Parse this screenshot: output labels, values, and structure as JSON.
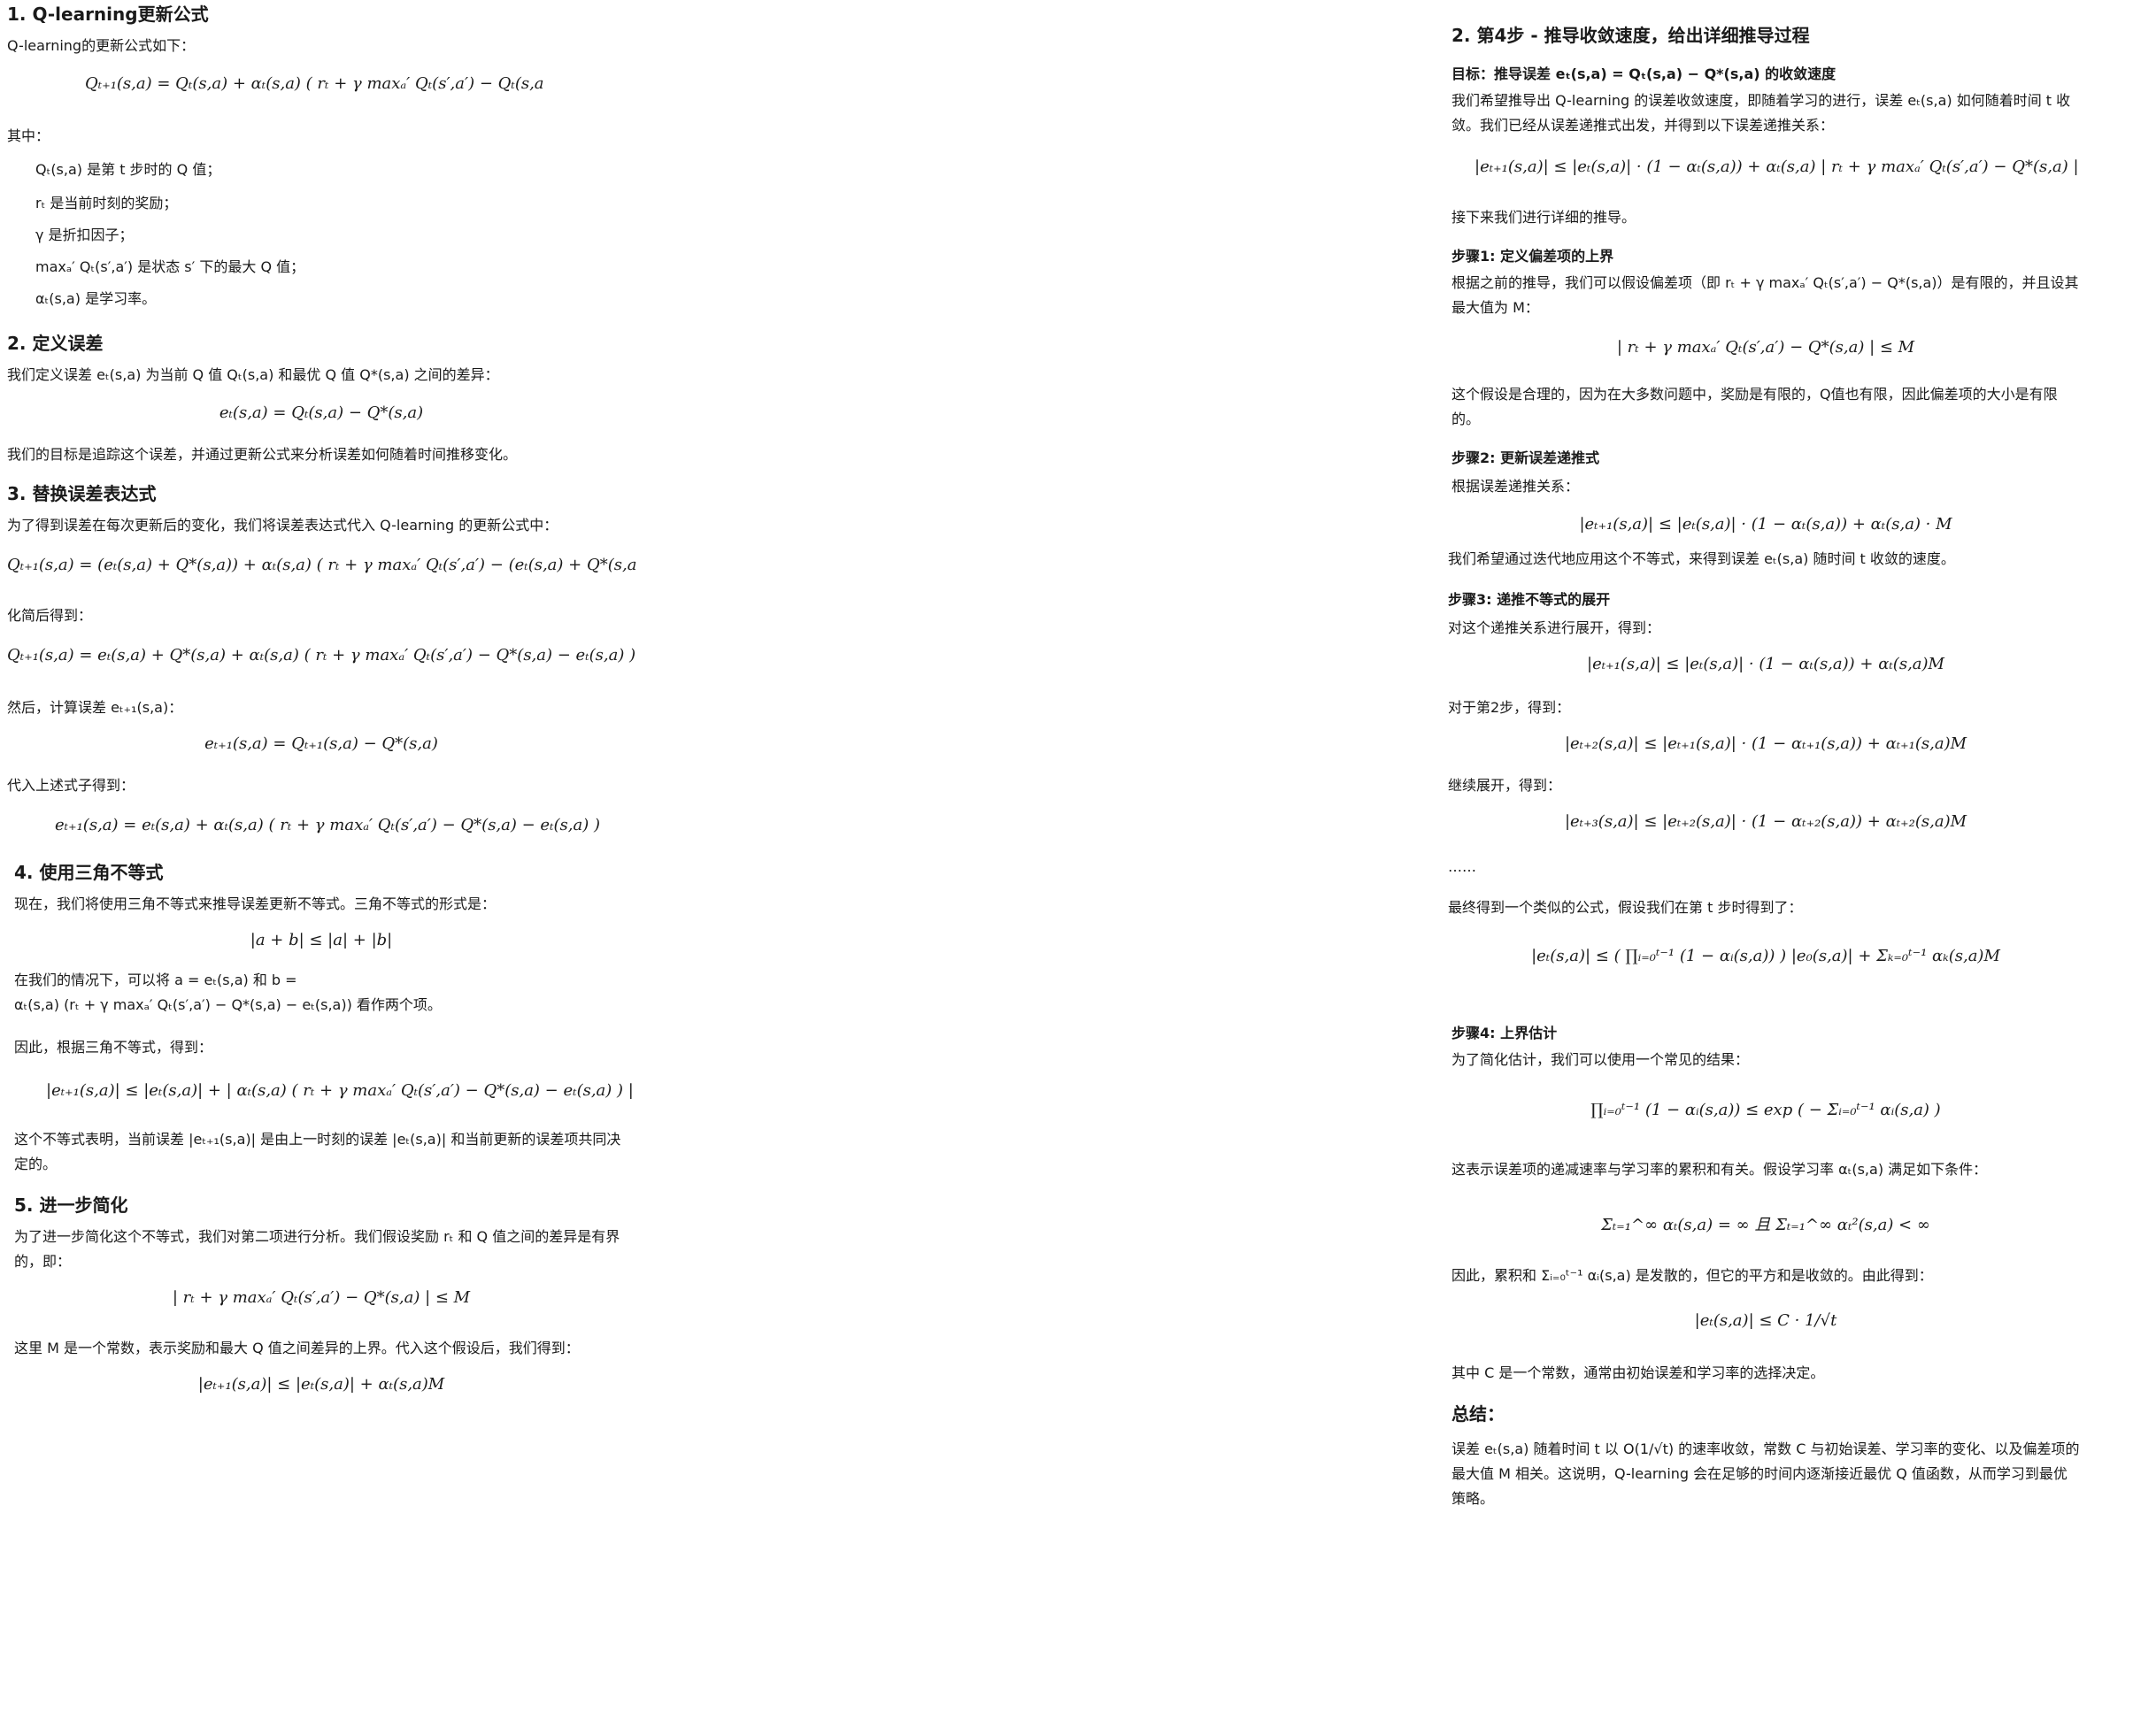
{
  "left": {
    "s1_title": "1. Q-learning更新公式",
    "s1_intro": "Q-learning的更新公式如下：",
    "s1_formula": "Qₜ₊₁(s,a) = Qₜ(s,a) + αₜ(s,a) ( rₜ + γ maxₐ′ Qₜ(s′,a′) − Qₜ(s,a",
    "s1_where": "其中：",
    "s1_items": [
      "Qₜ(s,a) 是第 t 步时的 Q 值；",
      "rₜ 是当前时刻的奖励；",
      "γ 是折扣因子；",
      "maxₐ′ Qₜ(s′,a′) 是状态 s′ 下的最大 Q 值；",
      "αₜ(s,a) 是学习率。"
    ],
    "s2_title": "2. 定义误差",
    "s2_text": "我们定义误差 eₜ(s,a) 为当前 Q 值 Qₜ(s,a) 和最优 Q 值 Q*(s,a) 之间的差异：",
    "s2_formula": "eₜ(s,a) = Qₜ(s,a) − Q*(s,a)",
    "s2_text2": "我们的目标是追踪这个误差，并通过更新公式来分析误差如何随着时间推移变化。",
    "s3_title": "3. 替换误差表达式",
    "s3_text": "为了得到误差在每次更新后的变化，我们将误差表达式代入 Q-learning 的更新公式中：",
    "s3_formula1": "Qₜ₊₁(s,a) = (eₜ(s,a) + Q*(s,a)) + αₜ(s,a) ( rₜ + γ maxₐ′ Qₜ(s′,a′) − (eₜ(s,a) + Q*(s,a",
    "s3_text2": "化简后得到：",
    "s3_formula2": "Qₜ₊₁(s,a) = eₜ(s,a) + Q*(s,a) + αₜ(s,a) ( rₜ + γ maxₐ′ Qₜ(s′,a′) − Q*(s,a) − eₜ(s,a) )",
    "s3_text3": "然后，计算误差 eₜ₊₁(s,a)：",
    "s3_formula3": "eₜ₊₁(s,a) = Qₜ₊₁(s,a) − Q*(s,a)",
    "s3_text4": "代入上述式子得到：",
    "s3_formula4": "eₜ₊₁(s,a) = eₜ(s,a) + αₜ(s,a) ( rₜ + γ maxₐ′ Qₜ(s′,a′) − Q*(s,a) − eₜ(s,a) )",
    "s4_title": "4. 使用三角不等式",
    "s4_text": "现在，我们将使用三角不等式来推导误差更新不等式。三角不等式的形式是：",
    "s4_formula1": "|a + b| ≤ |a| + |b|",
    "s4_text2a": "在我们的情况下，可以将 a = eₜ(s,a) 和 b =",
    "s4_text2b": "αₜ(s,a) (rₜ + γ maxₐ′ Qₜ(s′,a′) − Q*(s,a) − eₜ(s,a)) 看作两个项。",
    "s4_text3": "因此，根据三角不等式，得到：",
    "s4_formula2": "|eₜ₊₁(s,a)| ≤ |eₜ(s,a)| + | αₜ(s,a) ( rₜ + γ maxₐ′ Qₜ(s′,a′) − Q*(s,a) − eₜ(s,a) ) |",
    "s4_text4": "这个不等式表明，当前误差 |eₜ₊₁(s,a)| 是由上一时刻的误差 |eₜ(s,a)| 和当前更新的误差项共同决定的。",
    "s5_title": "5. 进一步简化",
    "s5_text": "为了进一步简化这个不等式，我们对第二项进行分析。我们假设奖励 rₜ 和 Q 值之间的差异是有界的，即：",
    "s5_formula1": "| rₜ + γ maxₐ′ Qₜ(s′,a′) − Q*(s,a) | ≤ M",
    "s5_text2": "这里 M 是一个常数，表示奖励和最大 Q 值之间差异的上界。代入这个假设后，我们得到：",
    "s5_formula2": "|eₜ₊₁(s,a)| ≤ |eₜ(s,a)| + αₜ(s,a)M"
  },
  "right": {
    "title": "2. 第4步 - 推导收敛速度，给出详细推导过程",
    "goal": "目标：推导误差 eₜ(s,a) = Qₜ(s,a) − Q*(s,a) 的收敛速度",
    "intro": "我们希望推导出 Q-learning 的误差收敛速度，即随着学习的进行，误差 eₜ(s,a) 如何随着时间 t 收敛。我们已经从误差递推式出发，并得到以下误差递推关系：",
    "formula0": "|eₜ₊₁(s,a)| ≤ |eₜ(s,a)| · (1 − αₜ(s,a)) + αₜ(s,a) | rₜ + γ maxₐ′ Qₜ(s′,a′) − Q*(s,a) |",
    "next": "接下来我们进行详细的推导。",
    "step1_title": "步骤1: 定义偏差项的上界",
    "step1_text": "根据之前的推导，我们可以假设偏差项（即 rₜ + γ maxₐ′ Qₜ(s′,a′) − Q*(s,a)）是有限的，并且设其最大值为 M：",
    "step1_formula": "| rₜ + γ maxₐ′ Qₜ(s′,a′) − Q*(s,a) | ≤ M",
    "step1_text2": "这个假设是合理的，因为在大多数问题中，奖励是有限的，Q值也有限，因此偏差项的大小是有限的。",
    "step2_title": "步骤2: 更新误差递推式",
    "step2_text": "根据误差递推关系：",
    "step2_formula": "|eₜ₊₁(s,a)| ≤ |eₜ(s,a)| · (1 − αₜ(s,a)) + αₜ(s,a) · M",
    "step2_text2": "我们希望通过迭代地应用这个不等式，来得到误差 eₜ(s,a) 随时间 t 收敛的速度。",
    "step3_title": "步骤3: 递推不等式的展开",
    "step3_text": "对这个递推关系进行展开，得到：",
    "step3_formula1": "|eₜ₊₁(s,a)| ≤ |eₜ(s,a)| · (1 − αₜ(s,a)) + αₜ(s,a)M",
    "step3_text2": "对于第2步，得到：",
    "step3_formula2": "|eₜ₊₂(s,a)| ≤ |eₜ₊₁(s,a)| · (1 − αₜ₊₁(s,a)) + αₜ₊₁(s,a)M",
    "step3_text3": "继续展开，得到：",
    "step3_formula3": "|eₜ₊₃(s,a)| ≤ |eₜ₊₂(s,a)| · (1 − αₜ₊₂(s,a)) + αₜ₊₂(s,a)M",
    "ellipsis": "……",
    "step3_text4": "最终得到一个类似的公式，假设我们在第 t 步时得到了：",
    "step3_formula4": "|eₜ(s,a)| ≤ ( ∏ᵢ₌₀ᵗ⁻¹ (1 − αᵢ(s,a)) ) |e₀(s,a)| + Σₖ₌₀ᵗ⁻¹ αₖ(s,a)M",
    "step4_title": "步骤4: 上界估计",
    "step4_text": "为了简化估计，我们可以使用一个常见的结果：",
    "step4_formula1": "∏ᵢ₌₀ᵗ⁻¹ (1 − αᵢ(s,a)) ≤ exp ( − Σᵢ₌₀ᵗ⁻¹ αᵢ(s,a) )",
    "step4_text2": "这表示误差项的递减速率与学习率的累积和有关。假设学习率 αₜ(s,a) 满足如下条件：",
    "step4_formula2": "Σₜ₌₁^∞ αₜ(s,a) = ∞    且    Σₜ₌₁^∞ αₜ²(s,a) < ∞",
    "step4_text3": "因此，累积和 Σᵢ₌₀ᵗ⁻¹ αᵢ(s,a) 是发散的，但它的平方和是收敛的。由此得到：",
    "step4_formula3": "|eₜ(s,a)| ≤ C · 1/√t",
    "step4_text4": "其中 C 是一个常数，通常由初始误差和学习率的选择决定。",
    "summary_title": "总结：",
    "summary_text": "误差 eₜ(s,a) 随着时间 t 以 O(1/√t) 的速率收敛，常数 C 与初始误差、学习率的变化、以及偏差项的最大值 M 相关。这说明，Q-learning 会在足够的时间内逐渐接近最优 Q 值函数，从而学习到最优策略。"
  }
}
